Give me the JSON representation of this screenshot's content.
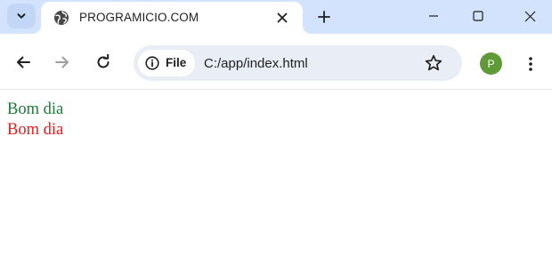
{
  "tabstrip": {
    "search_icon": "chevron-down-icon",
    "tab": {
      "title": "PROGRAMICIO.COM",
      "favicon": "globe-icon",
      "close_icon": "close-icon"
    },
    "new_tab_icon": "plus-icon",
    "window_controls": [
      "minimize-icon",
      "maximize-icon",
      "close-icon"
    ]
  },
  "toolbar": {
    "back_icon": "arrow-left-icon",
    "forward_icon": "arrow-right-icon",
    "reload_icon": "reload-icon",
    "omnibox": {
      "site_chip_label": "File",
      "site_chip_icon": "info-icon",
      "url": "C:/app/index.html",
      "bookmark_icon": "star-icon"
    },
    "profile_initial": "P",
    "profile_color": "#5f9a37",
    "menu_icon": "kebab-menu-icon"
  },
  "page": {
    "lines": [
      {
        "text": "Bom dia",
        "color": "#1c7a3a"
      },
      {
        "text": "Bom dia",
        "color": "#e21d1d"
      }
    ]
  }
}
